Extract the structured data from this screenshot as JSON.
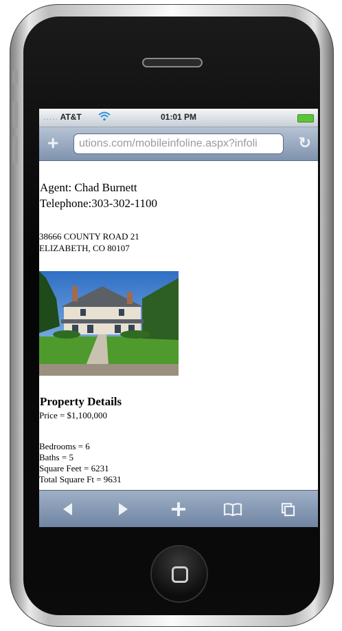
{
  "status_bar": {
    "signal": ".....",
    "carrier": "AT&T",
    "time": "01:01 PM"
  },
  "browser": {
    "url": "utions.com/mobileinfoline.aspx?infoli"
  },
  "listing": {
    "agent": "Agent: Chad Burnett",
    "telephone": "Telephone:303-302-1100",
    "address_line1": "38666 COUNTY ROAD 21",
    "address_line2": "ELIZABETH, CO 80107",
    "details_heading": "Property Details",
    "price": "Price = $1,100,000",
    "bedrooms": "Bedrooms = 6",
    "baths": "Baths = 5",
    "square_feet": "Square Feet = 6231",
    "total_square_ft": "Total Square Ft = 9631"
  },
  "icons": {
    "url_bar": [
      "add-bookmark-icon",
      "reload-icon"
    ],
    "toolbar": [
      "back-icon",
      "forward-icon",
      "add-icon",
      "bookmarks-icon",
      "pages-icon"
    ],
    "status": [
      "wifi-icon",
      "battery-icon"
    ]
  },
  "colors": {
    "toolbar": "#7f93ae",
    "battery": "#5dc43a",
    "url_text": "#9a9a9a"
  }
}
